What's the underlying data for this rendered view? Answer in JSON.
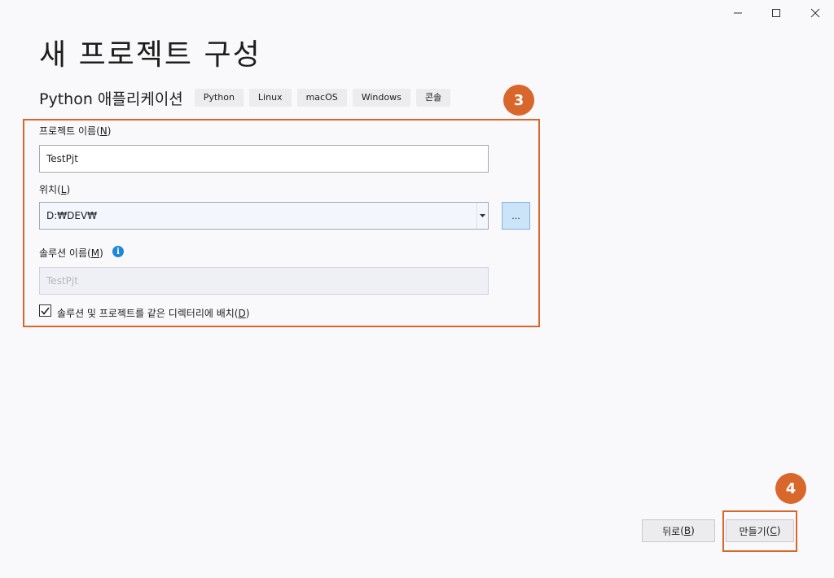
{
  "title": "새 프로젝트 구성",
  "template": {
    "name": "Python 애플리케이션",
    "tags": [
      "Python",
      "Linux",
      "macOS",
      "Windows",
      "콘솔"
    ]
  },
  "callouts": {
    "form": "3",
    "create": "4"
  },
  "form": {
    "project_name_label": "프로젝트 이름",
    "project_name_key": "N",
    "project_name_value": "TestPjt",
    "location_label": "위치",
    "location_key": "L",
    "location_value": "D:₩DEV₩",
    "browse_label": "...",
    "solution_name_label": "솔루션 이름",
    "solution_name_key": "M",
    "solution_name_value": "TestPjt",
    "same_dir_label": "솔루션 및 프로젝트를 같은 디렉터리에 배치",
    "same_dir_key": "D",
    "same_dir_checked": true
  },
  "buttons": {
    "back_label": "뒤로",
    "back_key": "B",
    "create_label": "만들기",
    "create_key": "C"
  },
  "colors": {
    "accent": "#d9662b",
    "info": "#1e88d6",
    "browse": "#cce4f7"
  }
}
